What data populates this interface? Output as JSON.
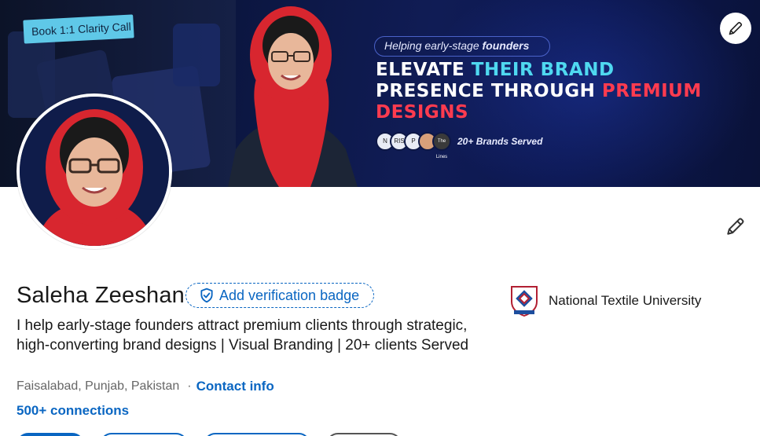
{
  "banner": {
    "book_tag": "Book 1:1 Clarity Call",
    "helping_prefix": "Helping early-stage ",
    "helping_bold": "founders",
    "headline_white_1": "ELEVATE ",
    "headline_cyan_1": "THEIR BRAND",
    "headline_white_2": "PRESENCE THROUGH ",
    "headline_red_1": "PREMIUM",
    "headline_red_2": "DESIGNS",
    "brands_served": "20+ Brands Served",
    "brand_logos": [
      "N",
      "RIS",
      "P",
      "",
      "The Lines"
    ]
  },
  "profile": {
    "name": "Saleha Zeeshan",
    "verify_label": "Add verification badge",
    "headline": "I help early-stage founders attract premium clients through strategic, high-converting brand designs | Visual Branding | 20+ clients Served",
    "location": "Faisalabad, Punjab, Pakistan",
    "separator": "·",
    "contact_label": "Contact info",
    "connections": "500+ connections"
  },
  "education": {
    "university": "National Textile  University"
  },
  "colors": {
    "link_blue": "#0a66c2",
    "hijab_red": "#d8262f",
    "banner_navy": "#0d1a3d"
  },
  "icons": {
    "edit_banner": "pencil-icon",
    "edit_intro": "pencil-icon",
    "verify": "shield-check-icon",
    "university": "university-crest-icon"
  }
}
